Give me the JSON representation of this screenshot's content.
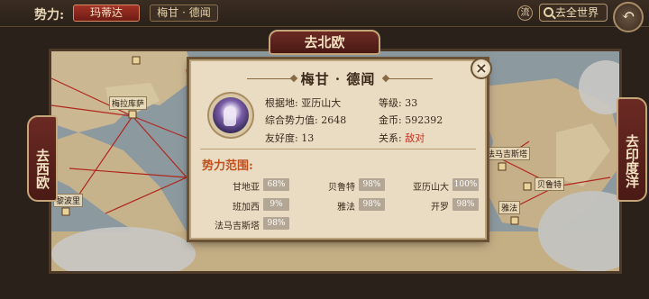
{
  "topbar": {
    "faction_label": "势力:",
    "faction_name": "玛蒂达",
    "current_player": "梅甘 · 德闻",
    "stream_button": "流",
    "world_button": "去全世界",
    "world_icon": "search-icon",
    "back_icon": "back-arrow-icon"
  },
  "nav": {
    "north": "去北欧",
    "west": "去西欧",
    "east": "去印度洋"
  },
  "map_labels": {
    "city1": "梅拉库萨",
    "city2": "法马吉斯塔",
    "city3": "贝鲁特",
    "city4": "雅法",
    "city5": "黎波里"
  },
  "dialog": {
    "title": "梅甘 · 德闻",
    "close_icon": "close-icon",
    "home_label": "根据地:",
    "home_value": "亚历山大",
    "level_label": "等级:",
    "level_value": "33",
    "power_label": "综合势力值:",
    "power_value": "2648",
    "gold_label": "金币:",
    "gold_value": "592392",
    "friend_label": "友好度:",
    "friend_value": "13",
    "relation_label": "关系:",
    "relation_value": "敌对",
    "relation_color": "#c23020",
    "section_title": "势力范围:",
    "territories": [
      {
        "name": "甘地亚",
        "pct": "68%"
      },
      {
        "name": "贝鲁特",
        "pct": "98%"
      },
      {
        "name": "亚历山大",
        "pct": "100%"
      },
      {
        "name": "班加西",
        "pct": "9%"
      },
      {
        "name": "雅法",
        "pct": "98%"
      },
      {
        "name": "开罗",
        "pct": "98%"
      },
      {
        "name": "法马吉斯塔",
        "pct": "98%"
      }
    ]
  }
}
